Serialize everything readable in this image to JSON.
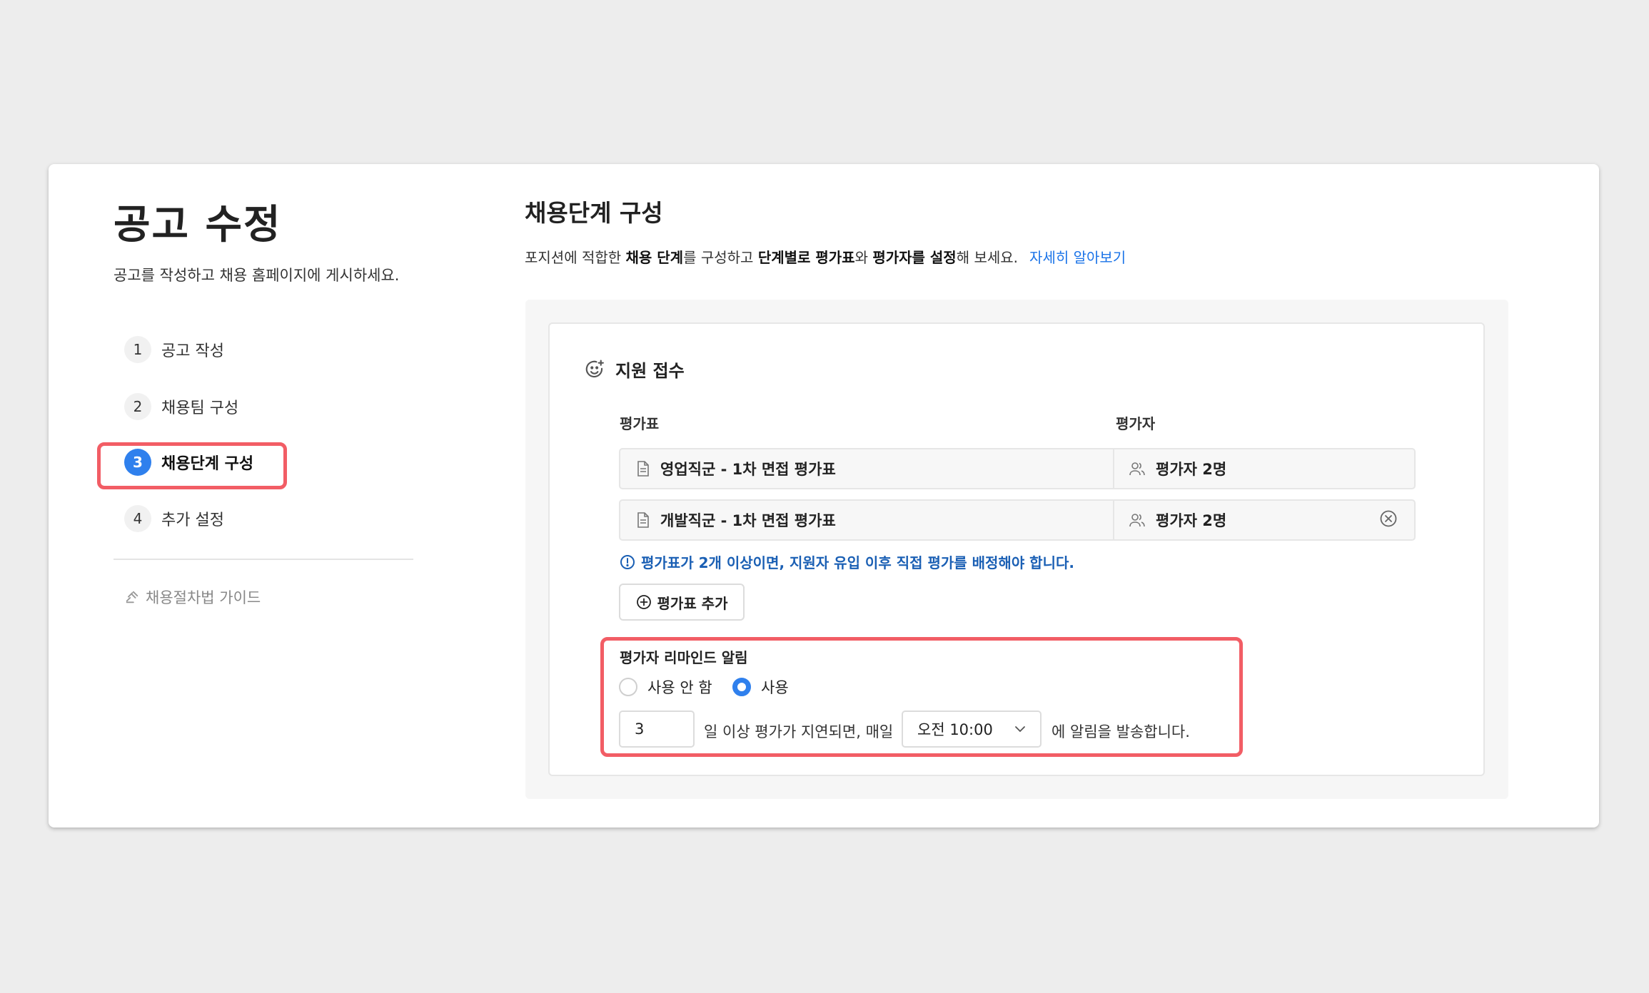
{
  "left": {
    "title": "공고 수정",
    "subtitle": "공고를 작성하고 채용 홈페이지에 게시하세요.",
    "steps": [
      {
        "num": "1",
        "label": "공고 작성"
      },
      {
        "num": "2",
        "label": "채용팀 구성"
      },
      {
        "num": "3",
        "label": "채용단계 구성"
      },
      {
        "num": "4",
        "label": "추가 설정"
      }
    ],
    "guide": "채용절차법 가이드"
  },
  "main": {
    "title": "채용단계 구성",
    "desc_part1": "포지션에 적합한 ",
    "desc_bold1": "채용 단계",
    "desc_part2": "를 구성하고 ",
    "desc_bold2": "단계별로 평가표",
    "desc_part3": "와 ",
    "desc_bold3": "평가자를 설정",
    "desc_part4": "해 보세요.",
    "learn_more": "자세히 알아보기",
    "stage": {
      "name": "지원 접수",
      "col_scorecard": "평가표",
      "col_evaluator": "평가자",
      "rows": [
        {
          "scorecard": "영업직군 - 1차 면접 평가표",
          "evaluator": "평가자 2명"
        },
        {
          "scorecard": "개발직군 - 1차 면접 평가표",
          "evaluator": "평가자 2명"
        }
      ],
      "notice": "평가표가 2개 이상이면, 지원자 유입 이후 직접 평가를 배정해야 합니다.",
      "add_button": "평가표 추가",
      "reminder": {
        "label": "평가자 리마인드 알림",
        "option_off": "사용 안 함",
        "option_on": "사용",
        "selected": "사용",
        "days": "3",
        "text_mid": "일 이상 평가가 지연되면, 매일",
        "time": "오전 10:00",
        "text_end": "에 알림을 발송합니다."
      }
    }
  },
  "colors": {
    "accent": "#2f80ed",
    "highlight": "#f25d65",
    "link": "#1a73e8",
    "notice": "#1a5fb4"
  }
}
